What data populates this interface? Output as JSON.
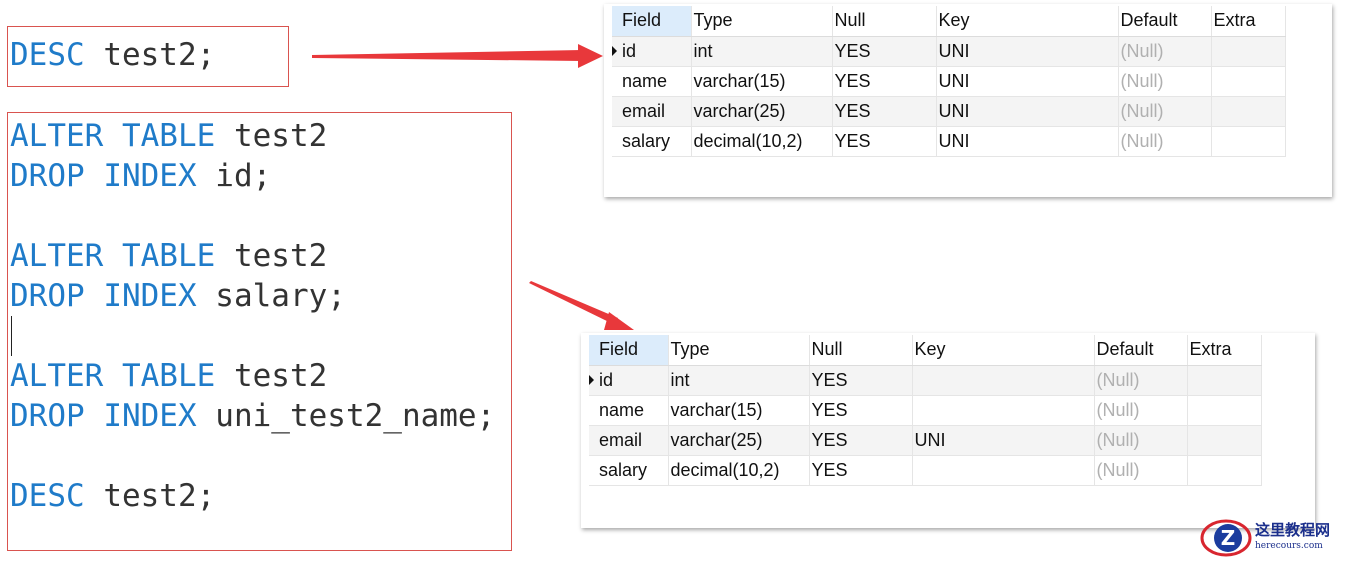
{
  "code_block_1": {
    "lines": [
      {
        "kw": "DESC",
        "rest": " test2;"
      }
    ]
  },
  "code_block_2": {
    "lines": [
      {
        "kw": "ALTER TABLE",
        "rest": " test2"
      },
      {
        "kw": "DROP INDEX",
        "rest": " id;"
      },
      {
        "kw": "",
        "rest": ""
      },
      {
        "kw": "ALTER TABLE",
        "rest": " test2"
      },
      {
        "kw": "DROP INDEX",
        "rest": " salary;"
      },
      {
        "kw": "",
        "rest": ""
      },
      {
        "kw": "ALTER TABLE",
        "rest": " test2"
      },
      {
        "kw": "DROP INDEX",
        "rest": " uni_test2_name;"
      },
      {
        "kw": "",
        "rest": ""
      },
      {
        "kw": "DESC",
        "rest": " test2;"
      }
    ]
  },
  "result_before": {
    "columns": [
      "Field",
      "Type",
      "Null",
      "Key",
      "Default",
      "Extra"
    ],
    "rows": [
      [
        "id",
        "int",
        "YES",
        "UNI",
        "(Null)",
        ""
      ],
      [
        "name",
        "varchar(15)",
        "YES",
        "UNI",
        "(Null)",
        ""
      ],
      [
        "email",
        "varchar(25)",
        "YES",
        "UNI",
        "(Null)",
        ""
      ],
      [
        "salary",
        "decimal(10,2)",
        "YES",
        "UNI",
        "(Null)",
        ""
      ]
    ]
  },
  "result_after": {
    "columns": [
      "Field",
      "Type",
      "Null",
      "Key",
      "Default",
      "Extra"
    ],
    "rows": [
      [
        "id",
        "int",
        "YES",
        "",
        "(Null)",
        ""
      ],
      [
        "name",
        "varchar(15)",
        "YES",
        "",
        "(Null)",
        ""
      ],
      [
        "email",
        "varchar(25)",
        "YES",
        "UNI",
        "(Null)",
        ""
      ],
      [
        "salary",
        "decimal(10,2)",
        "YES",
        "",
        "(Null)",
        ""
      ]
    ]
  },
  "watermark": {
    "logo_letter": "Z",
    "name_cn": "这里教程网",
    "domain": "herecours.com"
  },
  "colors": {
    "keyword": "#1f7bc9",
    "identifier": "#333333",
    "frame": "#d9534f",
    "arrow": "#e8383b",
    "null_text": "#b0b0b0",
    "header_highlight": "#dcecfb"
  }
}
